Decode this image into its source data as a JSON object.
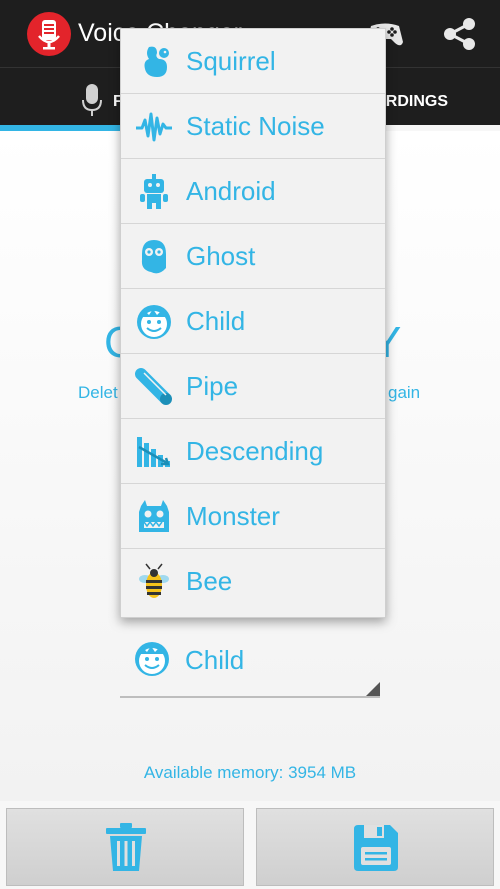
{
  "app": {
    "title": "Voice Changer",
    "accent_color": "#33b5e5",
    "actionbar_color": "#1e1e1e"
  },
  "actions": [
    {
      "icon": "gamepad-icon"
    },
    {
      "icon": "share-icon"
    }
  ],
  "tabs": [
    {
      "label": "F",
      "icon": "microphone-icon",
      "selected": true
    },
    {
      "label": "RDINGS",
      "selected": false
    }
  ],
  "main": {
    "big_text_left": "C",
    "big_text_right": "Y",
    "hint_left": "Delet",
    "hint_right": "gain"
  },
  "dropdown": {
    "items": [
      {
        "label": "Squirrel",
        "icon": "squirrel-icon"
      },
      {
        "label": "Static Noise",
        "icon": "static-noise-icon"
      },
      {
        "label": "Android",
        "icon": "android-icon"
      },
      {
        "label": "Ghost",
        "icon": "ghost-icon"
      },
      {
        "label": "Child",
        "icon": "child-icon"
      },
      {
        "label": "Pipe",
        "icon": "pipe-icon"
      },
      {
        "label": "Descending",
        "icon": "descending-icon"
      },
      {
        "label": "Monster",
        "icon": "monster-icon"
      },
      {
        "label": "Bee",
        "icon": "bee-icon"
      }
    ]
  },
  "spinner": {
    "selected_label": "Child",
    "selected_icon": "child-icon"
  },
  "memory_text": "Available memory: 3954 MB",
  "bottom_buttons": [
    {
      "icon": "trash-icon"
    },
    {
      "icon": "save-icon"
    }
  ]
}
